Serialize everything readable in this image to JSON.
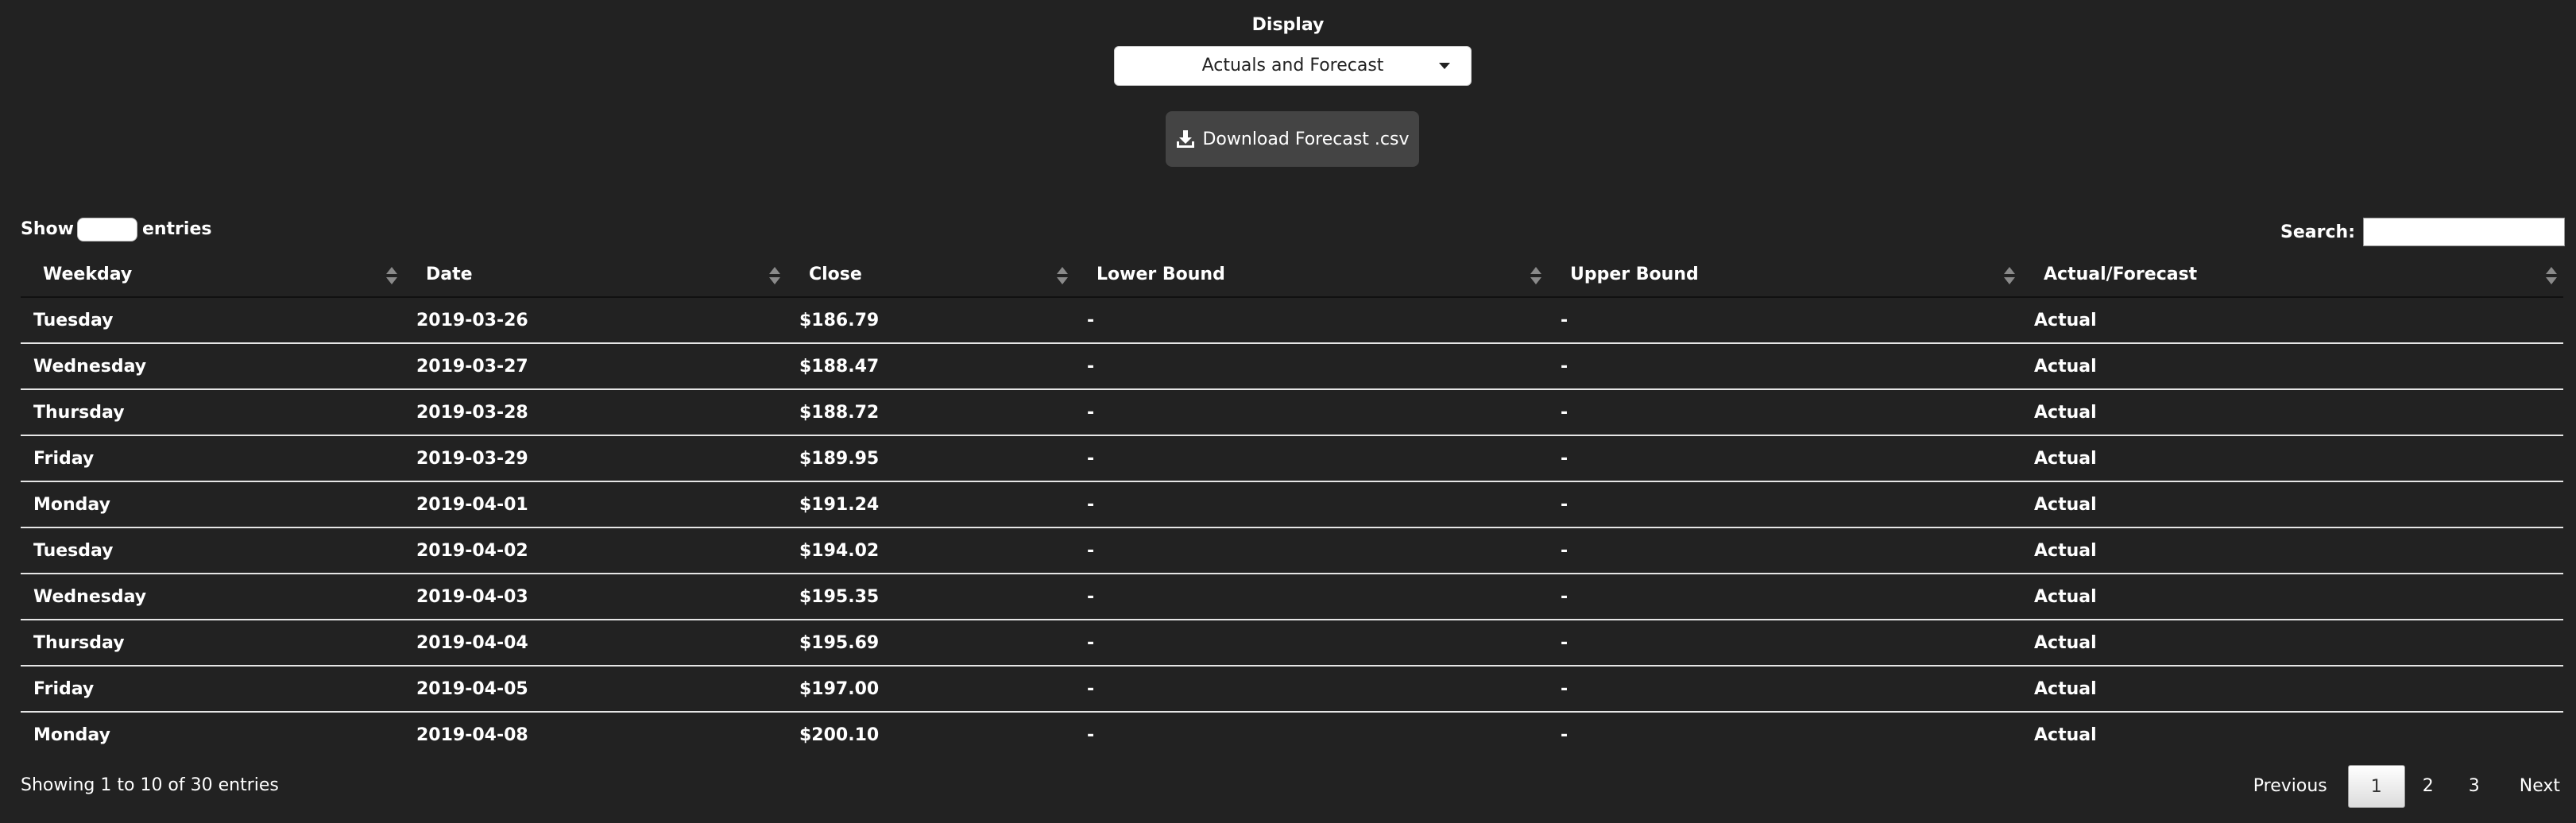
{
  "display": {
    "label": "Display",
    "selected": "Actuals and Forecast"
  },
  "download": {
    "label": "Download Forecast .csv",
    "icon": "download-icon"
  },
  "table_controls": {
    "show_label": "Show",
    "entries_label": "entries",
    "search_label": "Search:"
  },
  "table": {
    "columns": [
      "Weekday",
      "Date",
      "Close",
      "Lower Bound",
      "Upper Bound",
      "Actual/Forecast"
    ],
    "rows": [
      [
        "Tuesday",
        "2019-03-26",
        "$186.79",
        "-",
        "-",
        "Actual"
      ],
      [
        "Wednesday",
        "2019-03-27",
        "$188.47",
        "-",
        "-",
        "Actual"
      ],
      [
        "Thursday",
        "2019-03-28",
        "$188.72",
        "-",
        "-",
        "Actual"
      ],
      [
        "Friday",
        "2019-03-29",
        "$189.95",
        "-",
        "-",
        "Actual"
      ],
      [
        "Monday",
        "2019-04-01",
        "$191.24",
        "-",
        "-",
        "Actual"
      ],
      [
        "Tuesday",
        "2019-04-02",
        "$194.02",
        "-",
        "-",
        "Actual"
      ],
      [
        "Wednesday",
        "2019-04-03",
        "$195.35",
        "-",
        "-",
        "Actual"
      ],
      [
        "Thursday",
        "2019-04-04",
        "$195.69",
        "-",
        "-",
        "Actual"
      ],
      [
        "Friday",
        "2019-04-05",
        "$197.00",
        "-",
        "-",
        "Actual"
      ],
      [
        "Monday",
        "2019-04-08",
        "$200.10",
        "-",
        "-",
        "Actual"
      ]
    ]
  },
  "footer": {
    "info": "Showing 1 to 10 of 30 entries",
    "pagination": {
      "previous": "Previous",
      "pages": [
        "1",
        "2",
        "3"
      ],
      "current": "1",
      "next": "Next"
    }
  },
  "colors": {
    "background": "#222222",
    "button": "#444444",
    "text": "#ffffff"
  }
}
